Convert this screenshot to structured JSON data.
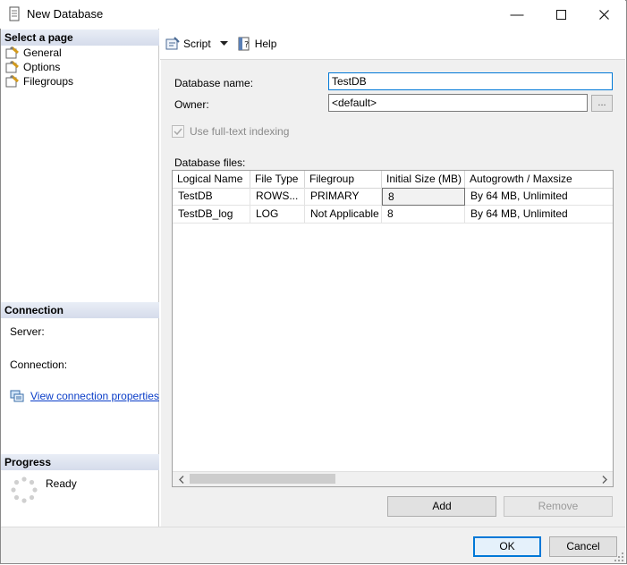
{
  "window": {
    "title": "New Database"
  },
  "left_pane": {
    "select_page_header": "Select a page",
    "pages": [
      {
        "label": "General"
      },
      {
        "label": "Options"
      },
      {
        "label": "Filegroups"
      }
    ],
    "connection_header": "Connection",
    "server_label": "Server:",
    "connection_label": "Connection:",
    "view_connection_link": "View connection properties",
    "progress_header": "Progress",
    "progress_status": "Ready"
  },
  "toolbar": {
    "script_label": "Script",
    "help_label": "Help"
  },
  "form": {
    "database_name_label": "Database name:",
    "database_name_value": "TestDB",
    "owner_label": "Owner:",
    "owner_value": "<default>",
    "owner_browse_label": "...",
    "fulltext_label": "Use full-text indexing",
    "database_files_label": "Database files:"
  },
  "grid": {
    "columns": [
      "Logical Name",
      "File Type",
      "Filegroup",
      "Initial Size (MB)",
      "Autogrowth / Maxsize"
    ],
    "rows": [
      [
        "TestDB",
        "ROWS...",
        "PRIMARY",
        "8",
        "By 64 MB, Unlimited"
      ],
      [
        "TestDB_log",
        "LOG",
        "Not Applicable",
        "8",
        "By 64 MB, Unlimited"
      ]
    ]
  },
  "buttons": {
    "add": "Add",
    "remove": "Remove",
    "ok": "OK",
    "cancel": "Cancel"
  },
  "colors": {
    "accent": "#0078d7",
    "link": "#0a3dc8",
    "section_header": "#dde4ef"
  }
}
